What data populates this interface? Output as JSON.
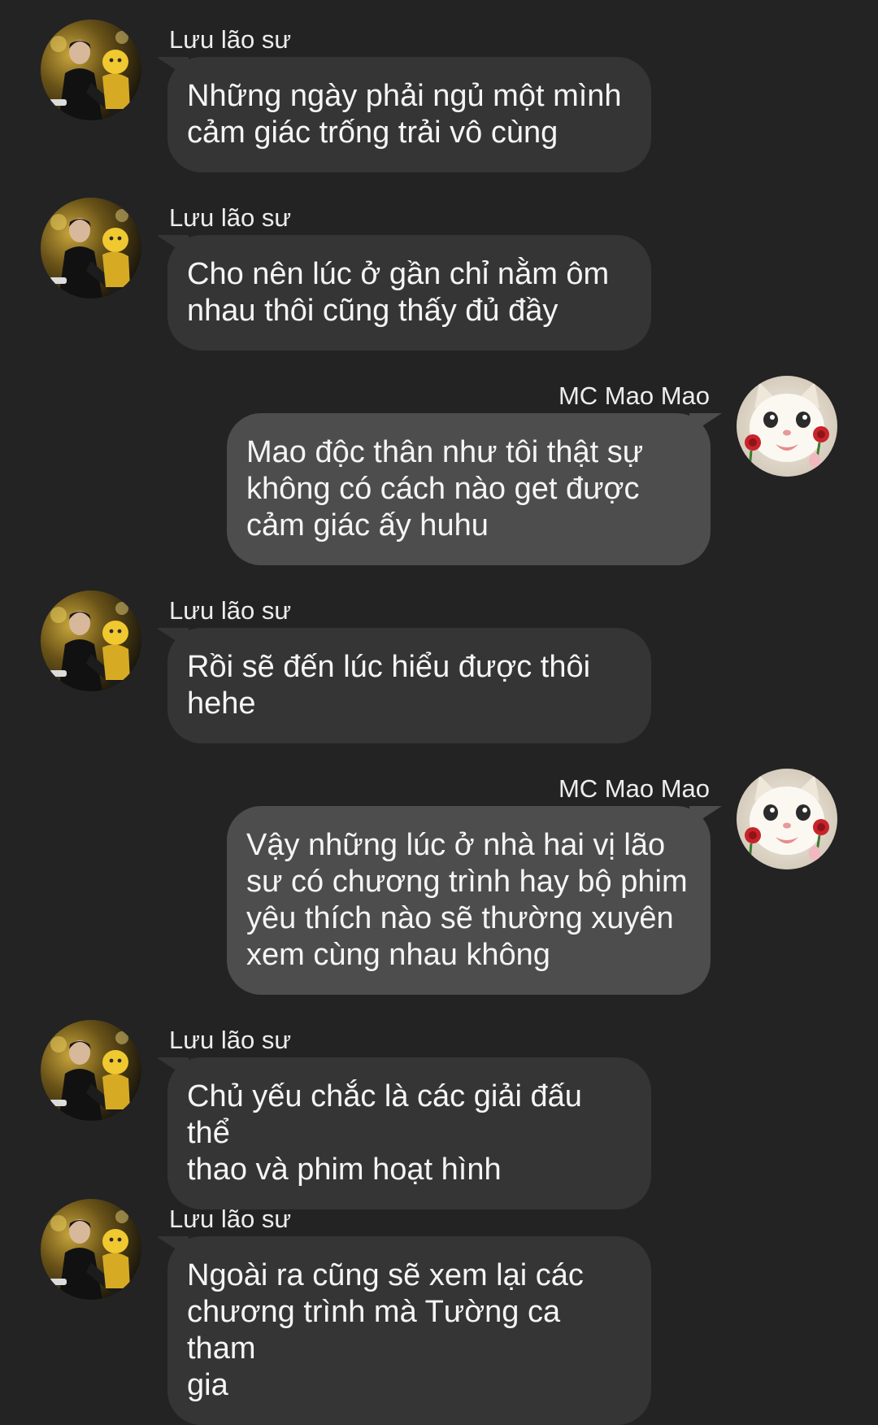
{
  "conversation": {
    "messages": [
      {
        "side": "left",
        "sender": "Lưu lão sư",
        "avatar_icon": "profile-photo-man-icon",
        "text": "Những ngày phải ngủ một mình\ncảm giác trống trải vô cùng"
      },
      {
        "side": "left",
        "sender": "Lưu lão sư",
        "avatar_icon": "profile-photo-man-icon",
        "text": "Cho nên lúc ở gần chỉ nằm ôm\nnhau thôi cũng thấy đủ đầy"
      },
      {
        "side": "right",
        "sender": "MC Mao Mao",
        "avatar_icon": "white-kitten-with-roses-icon",
        "text": "Mao độc thân như tôi thật sự\nkhông có cách nào get được\ncảm giác ấy huhu"
      },
      {
        "side": "left",
        "sender": "Lưu lão sư",
        "avatar_icon": "profile-photo-man-icon",
        "text": "Rồi sẽ đến lúc hiểu được thôi\nhehe"
      },
      {
        "side": "right",
        "sender": "MC Mao Mao",
        "avatar_icon": "white-kitten-with-roses-icon",
        "text": "Vậy những lúc ở nhà hai vị lão\nsư có chương trình hay bộ phim\nyêu thích nào sẽ thường xuyên\nxem cùng nhau không"
      },
      {
        "side": "left",
        "sender": "Lưu lão sư",
        "avatar_icon": "profile-photo-man-icon",
        "text": "Chủ yếu chắc là các giải đấu thể\nthao và phim hoạt hình"
      },
      {
        "side": "left",
        "sender": "Lưu lão sư",
        "avatar_icon": "profile-photo-man-icon",
        "text": "Ngoài ra cũng sẽ xem lại các\nchương trình mà Tường ca tham\ngia"
      }
    ]
  },
  "colors": {
    "background": "#232323",
    "incoming_bubble": "#353535",
    "outgoing_bubble": "#4d4d4d",
    "text": "#f5f5f5"
  }
}
